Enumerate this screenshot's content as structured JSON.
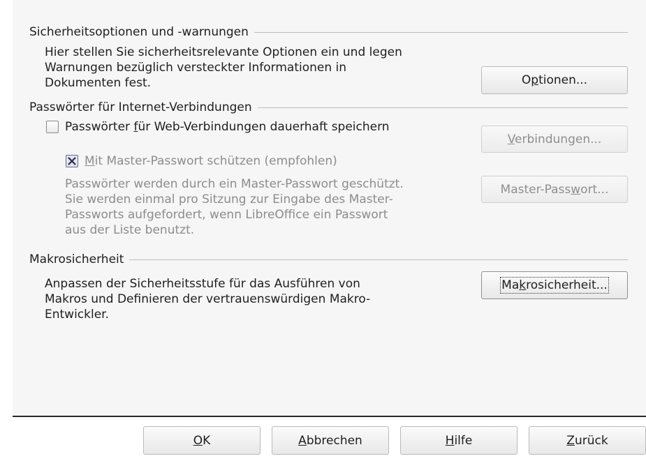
{
  "sections": {
    "security_options": {
      "heading": "Sicherheitsoptionen und -warnungen",
      "description": [
        "Hier stellen Sie sicherheitsrelevante Optionen ein und legen",
        "Warnungen bezüglich versteckter Informationen in",
        "Dokumenten fest."
      ],
      "button": {
        "pre": "O",
        "key": "p",
        "post": "tionen..."
      }
    },
    "passwords": {
      "heading": "Passwörter für Internet-Verbindungen",
      "save_checkbox": {
        "pre": "Passwörter ",
        "key": "f",
        "post": "ür Web-Verbindungen dauerhaft speichern",
        "checked": false
      },
      "connections_button": {
        "pre": "",
        "key": "V",
        "post": "erbindungen..."
      },
      "master_checkbox": {
        "pre": "",
        "key": "M",
        "post": "it Master-Passwort schützen (empfohlen)",
        "checked": true
      },
      "master_description": [
        "Passwörter werden durch ein Master-Passwort geschützt.",
        "Sie werden einmal pro Sitzung zur Eingabe des Master-",
        "Passworts aufgefordert, wenn LibreOffice ein Passwort",
        "aus der Liste benutzt."
      ],
      "master_button": {
        "pre": "Master-Pass",
        "key": "w",
        "post": "ort..."
      }
    },
    "macro_security": {
      "heading": "Makrosicherheit",
      "description": [
        "Anpassen der Sicherheitsstufe für das Ausführen von",
        "Makros und Definieren der vertrauenswürdigen Makro-",
        "Entwickler."
      ],
      "button": {
        "pre": "Ma",
        "key": "k",
        "post": "rosicherheit..."
      }
    }
  },
  "footer": {
    "ok": {
      "pre": "",
      "key": "O",
      "post": "K"
    },
    "cancel": {
      "pre": "",
      "key": "A",
      "post": "bbrechen"
    },
    "help": {
      "pre": "",
      "key": "H",
      "post": "ilfe"
    },
    "back": {
      "pre": "",
      "key": "Z",
      "post": "urück"
    }
  }
}
